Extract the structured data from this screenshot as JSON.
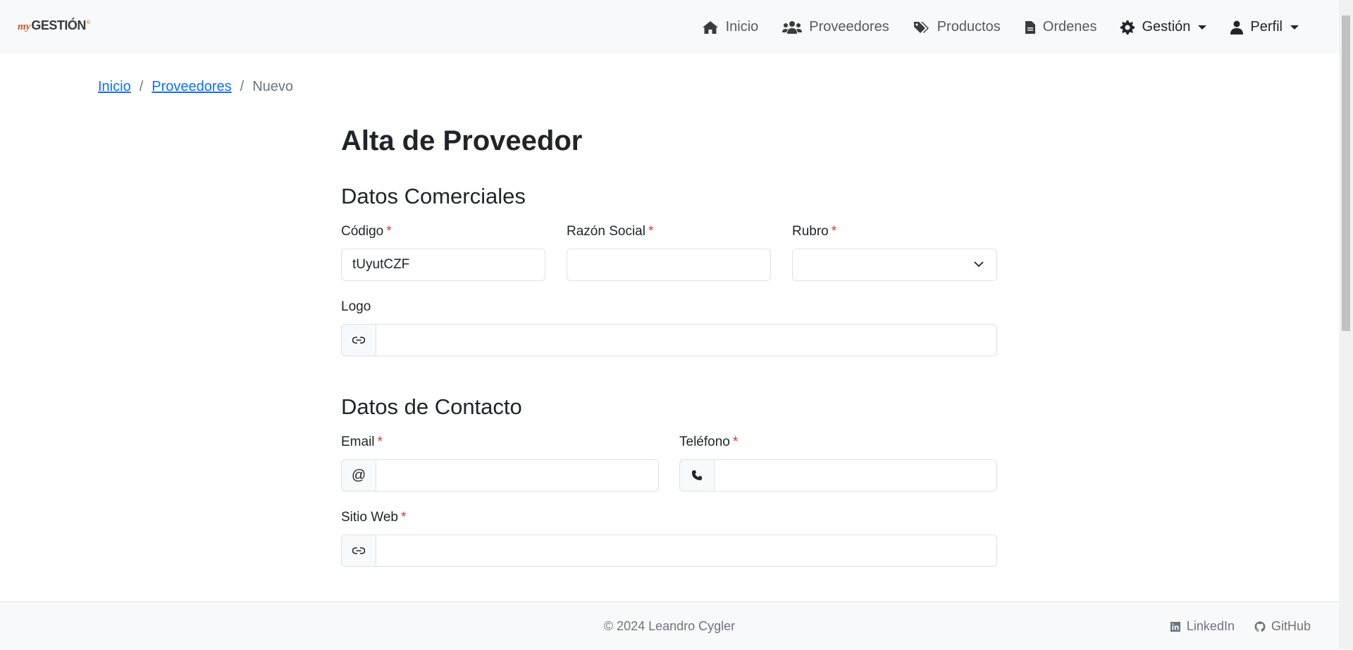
{
  "brand": {
    "my": "my",
    "name": "GESTIÓN",
    "reg": "®"
  },
  "nav": {
    "inicio": "Inicio",
    "proveedores": "Proveedores",
    "productos": "Productos",
    "ordenes": "Ordenes",
    "gestion": "Gestión",
    "perfil": "Perfil"
  },
  "breadcrumb": {
    "home": "Inicio",
    "parent": "Proveedores",
    "current": "Nuevo",
    "separator": "/"
  },
  "page": {
    "title": "Alta de Proveedor"
  },
  "comercial": {
    "heading": "Datos Comerciales",
    "codigo_label": "Código",
    "codigo_value": "tUyutCZF",
    "razon_label": "Razón Social",
    "razon_value": "",
    "rubro_label": "Rubro",
    "rubro_value": "",
    "logo_label": "Logo"
  },
  "contacto": {
    "heading": "Datos de Contacto",
    "email_label": "Email",
    "email_addon": "@",
    "telefono_label": "Teléfono",
    "sitio_label": "Sitio Web"
  },
  "required_mark": "*",
  "footer": {
    "copyright": "© 2024 Leandro Cygler",
    "linkedin": "LinkedIn",
    "github": "GitHub"
  },
  "colors": {
    "navbar_bg": "#f8f9fa",
    "link": "#0d6efd",
    "required": "#dc3545",
    "border": "#dee2e6"
  }
}
